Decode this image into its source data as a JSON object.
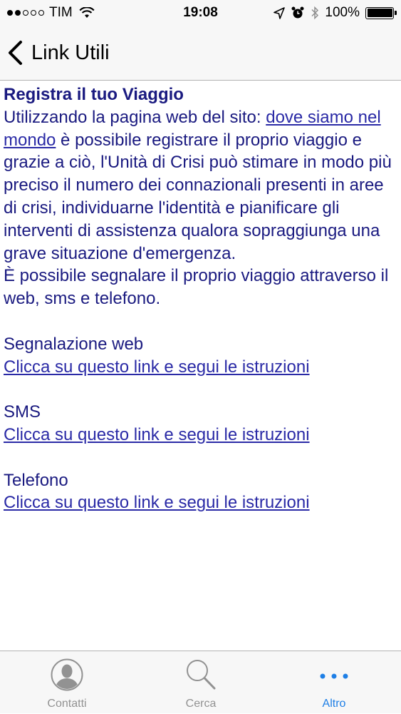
{
  "status_bar": {
    "carrier": "TIM",
    "time": "19:08",
    "battery": "100%",
    "battery_level": 1.0,
    "signal_bars_filled": 2,
    "signal_bars_total": 5
  },
  "nav": {
    "back_label": "Link Utili"
  },
  "content": {
    "title": "Registra il tuo Viaggio",
    "intro_before_link": "Utilizzando la pagina web del sito: ",
    "intro_link": "dove siamo nel mondo",
    "intro_after_link": " è possibile registrare il proprio viaggio e grazie a ciò, l'Unità di Crisi può stimare in modo più preciso il numero dei connazionali presenti in aree di crisi, individuarne l'identità e pianificare gli interventi di assistenza qualora sopraggiunga una grave situazione d'emergenza.",
    "intro_line2": "È possibile segnalare il proprio viaggio attraverso il web, sms e telefono.",
    "sections": [
      {
        "label": "Segnalazione web",
        "link": "Clicca su questo link e segui le istruzioni"
      },
      {
        "label": "SMS",
        "link": "Clicca su questo link e segui le istruzioni"
      },
      {
        "label": "Telefono",
        "link": "Clicca su questo link e segui le istruzioni"
      }
    ]
  },
  "tab_bar": {
    "tabs": [
      {
        "label": "Contatti",
        "icon": "person-icon",
        "active": false
      },
      {
        "label": "Cerca",
        "icon": "search-icon",
        "active": false
      },
      {
        "label": "Altro",
        "icon": "more-icon",
        "active": true
      }
    ],
    "active_color": "#1e7fe6",
    "inactive_color": "#929292"
  },
  "colors": {
    "text": "#1a1a80",
    "link": "#2a2aa6",
    "bar_background": "#f7f7f7"
  }
}
